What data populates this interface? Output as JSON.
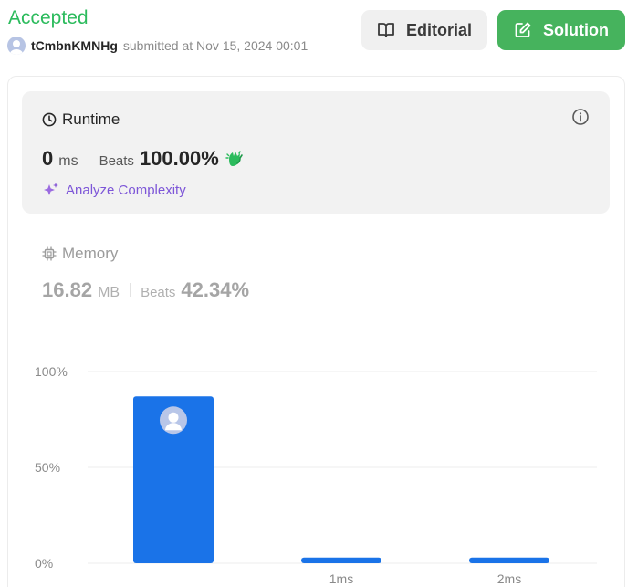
{
  "header": {
    "status": "Accepted",
    "username": "tCmbnKMNHg",
    "submitted_text": "submitted at Nov 15, 2024 00:01"
  },
  "buttons": {
    "editorial": "Editorial",
    "solution": "Solution"
  },
  "runtime": {
    "title": "Runtime",
    "value": "0",
    "unit": "ms",
    "beats_label": "Beats",
    "beats_value": "100.00%",
    "analyze_label": "Analyze Complexity"
  },
  "memory": {
    "title": "Memory",
    "value": "16.82",
    "unit": "MB",
    "beats_label": "Beats",
    "beats_value": "42.34%"
  },
  "colors": {
    "accepted": "#2cbb5d",
    "solution_button": "#46b35d",
    "bar": "#1a73e8",
    "analyze": "#7d56d8"
  },
  "icons": {
    "editorial": "book-icon",
    "solution": "edit-icon",
    "runtime": "clock-icon",
    "info": "info-icon",
    "beats": "clap-icon",
    "analyze": "sparkle-icon",
    "memory": "chip-icon"
  },
  "chart_data": {
    "type": "bar",
    "categories": [
      "",
      "1ms",
      "2ms"
    ],
    "values": [
      87,
      3,
      3
    ],
    "ylim": [
      0,
      100
    ],
    "ytick_labels": [
      "100%",
      "50%",
      "0%"
    ],
    "yticks": [
      100,
      50,
      0
    ],
    "grid": true,
    "marker_on_category": 0
  }
}
